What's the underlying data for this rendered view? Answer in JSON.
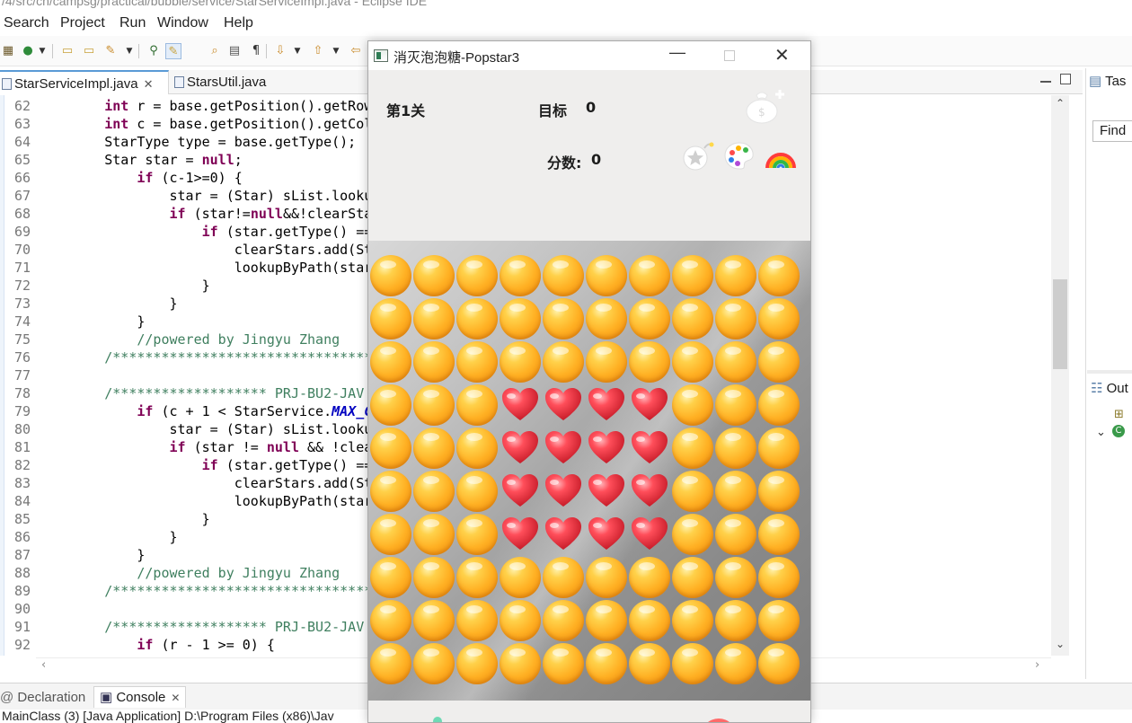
{
  "window_title": "/4/src/cn/campsg/practical/bubble/service/StarServiceImpl.java - Eclipse IDE",
  "menu": [
    "Search",
    "Project",
    "Run",
    "Window",
    "Help"
  ],
  "toolbar_icons": [
    "new-icon",
    "run-icon",
    "open-folder-icon",
    "folder-icon",
    "wand-icon",
    "pin-icon",
    "mark-icon",
    "search-file-icon",
    "doc-icon",
    "pilcrow-icon",
    "next-annotation-icon",
    "prev-annotation-icon",
    "back-icon"
  ],
  "editor": {
    "tabs": [
      {
        "label": "StarServiceImpl.java",
        "close": "✕",
        "active": true
      },
      {
        "label": "StarsUtil.java",
        "close": "",
        "active": false
      }
    ],
    "lines": [
      {
        "n": "62",
        "code": "        int r = base.getPosition().getRow"
      },
      {
        "n": "63",
        "code": "        int c = base.getPosition().getCol"
      },
      {
        "n": "64",
        "code": "        StarType type = base.getType();"
      },
      {
        "n": "65",
        "code": "        Star star = null;"
      },
      {
        "n": "66",
        "code": "            if (c-1>=0) {"
      },
      {
        "n": "67",
        "code": "                star = (Star) sList.looku"
      },
      {
        "n": "68",
        "code": "                if (star!=null&&!clearSta"
      },
      {
        "n": "69",
        "code": "                    if (star.getType() =="
      },
      {
        "n": "70",
        "code": "                        clearStars.add(St"
      },
      {
        "n": "71",
        "code": "                        lookupByPath(star"
      },
      {
        "n": "72",
        "code": "                    }"
      },
      {
        "n": "73",
        "code": "                }"
      },
      {
        "n": "74",
        "code": "            }"
      },
      {
        "n": "75",
        "code": "            //powered by Jingyu Zhang"
      },
      {
        "n": "76",
        "code": "        /*********************************"
      },
      {
        "n": "77",
        "code": ""
      },
      {
        "n": "78",
        "code": "        /******************* PRJ-BU2-JAV"
      },
      {
        "n": "79",
        "code": "            if (c + 1 < StarService.MAX_C"
      },
      {
        "n": "80",
        "code": "                star = (Star) sList.looku"
      },
      {
        "n": "81",
        "code": "                if (star != null && !clea"
      },
      {
        "n": "82",
        "code": "                    if (star.getType() =="
      },
      {
        "n": "83",
        "code": "                        clearStars.add(St"
      },
      {
        "n": "84",
        "code": "                        lookupByPath(star"
      },
      {
        "n": "85",
        "code": "                    }"
      },
      {
        "n": "86",
        "code": "                }"
      },
      {
        "n": "87",
        "code": "            }"
      },
      {
        "n": "88",
        "code": "            //powered by Jingyu Zhang"
      },
      {
        "n": "89",
        "code": "        /*********************************"
      },
      {
        "n": "90",
        "code": ""
      },
      {
        "n": "91",
        "code": "        /******************* PRJ-BU2-JAV"
      },
      {
        "n": "92",
        "code": "            if (r - 1 >= 0) {"
      }
    ]
  },
  "right_views": {
    "tasks_tab": "Tas",
    "find_placeholder": "Find",
    "outline_tab": "Out"
  },
  "bottom_views": {
    "tabs": [
      {
        "label": "Declaration",
        "active": false
      },
      {
        "label": "Console",
        "active": true,
        "close": "✕"
      }
    ],
    "console_text": "MainClass (3) [Java Application] D:\\Program Files (x86)\\Jav"
  },
  "game": {
    "title": "消灭泡泡糖-Popstar3",
    "level": "第1关",
    "target_label": "目标",
    "target_value": "0",
    "score_label": "分数:",
    "score_value": "0",
    "tool_icons": [
      "money-bag-icon",
      "star-bomb-icon",
      "palette-icon",
      "rainbow-icon"
    ],
    "board": {
      "rows": 10,
      "cols": 10,
      "grid": [
        "OOOOOOOOOO",
        "OOOOOOOOOO",
        "OOOOOOOOOO",
        "OOOHHHHOOO",
        "OOOHHHHOOO",
        "OOOHHHHOOO",
        "OOOHHHHOOO",
        "OOOOOOOOOO",
        "OOOOOOOOOO",
        "OOOOOOOOOO"
      ],
      "legend": {
        "O": "orange-star",
        "H": "red-heart"
      }
    }
  },
  "colors": {
    "keyword": "#7f0055",
    "comment": "#3f7f5f",
    "constant": "#0000c0",
    "accent": "#5a9ad6",
    "orange_star": "#ffb023",
    "red_heart": "#e8343f"
  }
}
